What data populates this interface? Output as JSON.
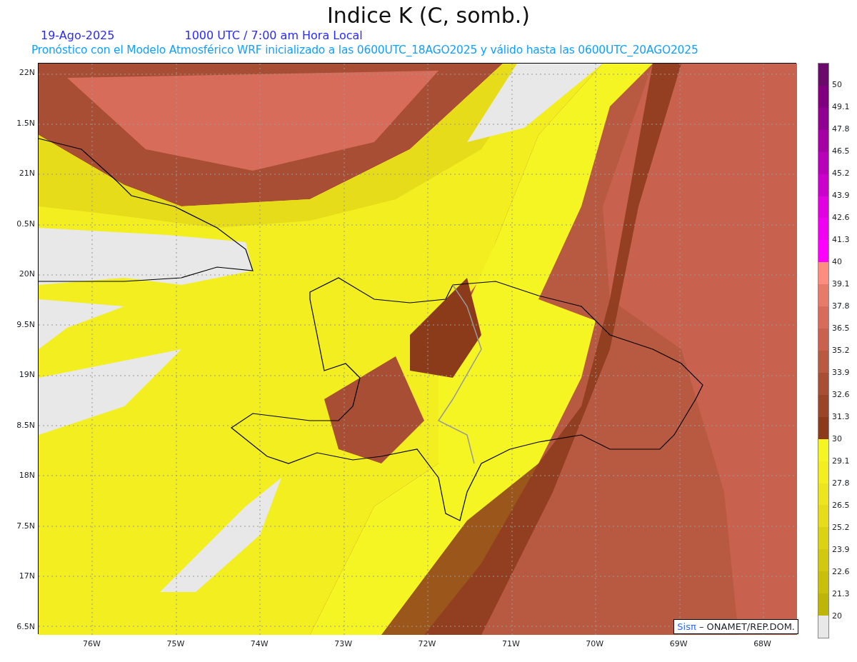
{
  "title": "Indice K (C, somb.)",
  "date": "19-Ago-2025",
  "time": "1000 UTC / 7:00 am Hora Local",
  "subtitle": "Pronóstico con el Modelo Atmosférico WRF inicializado a las 0600UTC_18AGO2025 y válido hasta las  0600UTC_20AGO2025",
  "y_labels": [
    "22N",
    "1.5N",
    "21N",
    "0.5N",
    "20N",
    "9.5N",
    "19N",
    "8.5N",
    "18N",
    "7.5N",
    "17N",
    "6.5N"
  ],
  "x_labels": [
    "76W",
    "75W",
    "74W",
    "73W",
    "72W",
    "71W",
    "70W",
    "69W",
    "68W"
  ],
  "colorbar": {
    "labels": [
      "50",
      "49.1",
      "47.8",
      "46.5",
      "45.2",
      "43.9",
      "42.6",
      "41.3",
      "40",
      "39.1",
      "37.8",
      "36.5",
      "35.2",
      "33.9",
      "32.6",
      "31.3",
      "30",
      "29.1",
      "27.8",
      "26.5",
      "25.2",
      "23.9",
      "22.6",
      "21.3",
      "20"
    ],
    "bins": [
      {
        "color": "#6a0a6a"
      },
      {
        "color": "#7e007e"
      },
      {
        "color": "#900090"
      },
      {
        "color": "#a400a4"
      },
      {
        "color": "#b800b8"
      },
      {
        "color": "#cc00cc"
      },
      {
        "color": "#e000e0"
      },
      {
        "color": "#f000f0"
      },
      {
        "color": "#ff00ff"
      },
      {
        "color": "#ff8c80"
      },
      {
        "color": "#e87a6a"
      },
      {
        "color": "#d86c5a"
      },
      {
        "color": "#c8624e"
      },
      {
        "color": "#b85a42"
      },
      {
        "color": "#a84e34"
      },
      {
        "color": "#9a4428"
      },
      {
        "color": "#8b3a1a"
      },
      {
        "color": "#f5f523"
      },
      {
        "color": "#f2ee20"
      },
      {
        "color": "#ede61e"
      },
      {
        "color": "#e6dc19"
      },
      {
        "color": "#dcd214"
      },
      {
        "color": "#d2c80f"
      },
      {
        "color": "#c8c00a"
      },
      {
        "color": "#bdb508"
      },
      {
        "color": "#e8e8e8"
      }
    ]
  },
  "credit": {
    "brand": "Sisπ",
    "org": "– ONAMET/REP.DOM."
  }
}
